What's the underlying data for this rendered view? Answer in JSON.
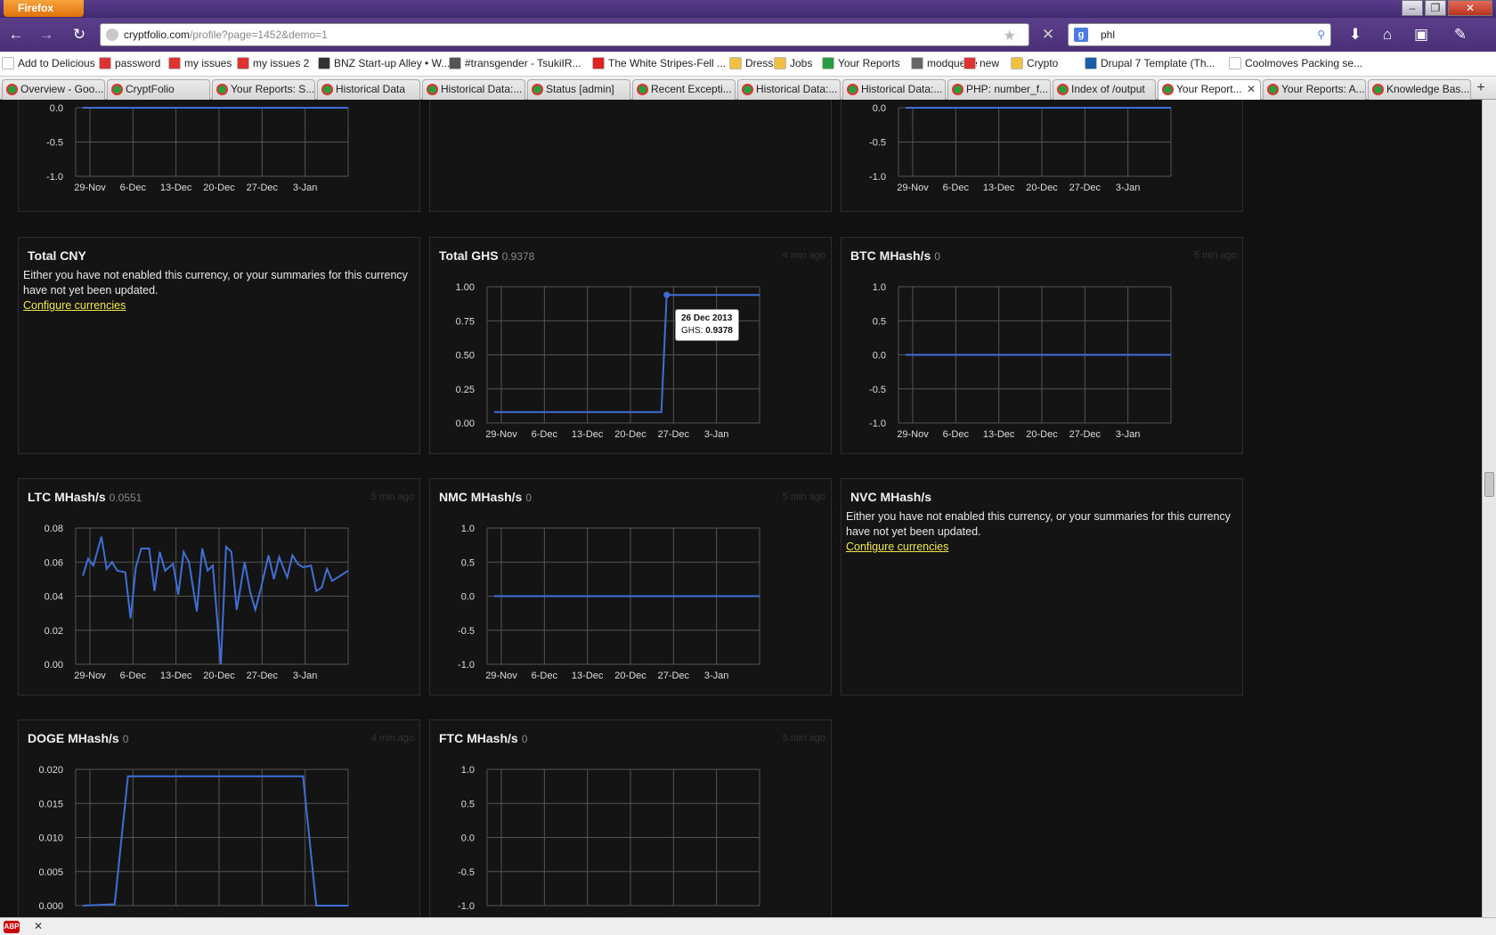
{
  "browser": {
    "menu_button": "Firefox",
    "url_host": "cryptfolio.com",
    "url_path": "/profile?page=1452&demo=1",
    "search_text": "phl",
    "search_engine_glyph": "g",
    "bookmarks": [
      "Add to Delicious",
      "password",
      "my issues",
      "my issues 2",
      "BNZ Start-up Alley • W...",
      "#transgender - TsukiIR...",
      "The White Stripes-Fell ...",
      "Dresses",
      "Jobs",
      "Your Reports",
      "modqueue",
      "new",
      "Crypto",
      "Drupal 7 Template (Th...",
      "Coolmoves Packing se..."
    ],
    "tabs": [
      "Overview - Goo...",
      "CryptFolio",
      "Your Reports: S...",
      "Historical Data",
      "Historical Data:...",
      "Status [admin]",
      "Recent Excepti...",
      "Historical Data:...",
      "Historical Data:...",
      "PHP: number_f...",
      "Index of /output",
      "Your Report...",
      "Your Reports: A...",
      "Knowledge Bas..."
    ],
    "active_tab_index": 11
  },
  "panels": {
    "top1": {},
    "top2": {},
    "top3": {},
    "cny": {
      "title": "Total CNY",
      "message": "Either you have not enabled this currency, or your summaries for this currency have not yet been updated.",
      "link": "Configure currencies"
    },
    "ghs": {
      "title": "Total GHS",
      "value": "0.9378",
      "ago": "4 min ago"
    },
    "btc": {
      "title": "BTC MHash/s",
      "value": "0",
      "ago": "5 min ago"
    },
    "ltc": {
      "title": "LTC MHash/s",
      "value": "0.0551",
      "ago": "5 min ago"
    },
    "nmc": {
      "title": "NMC MHash/s",
      "value": "0",
      "ago": "5 min ago"
    },
    "nvc": {
      "title": "NVC MHash/s",
      "message": "Either you have not enabled this currency, or your summaries for this currency have not yet been updated.",
      "link": "Configure currencies"
    },
    "doge": {
      "title": "DOGE MHash/s",
      "value": "0",
      "ago": "4 min ago"
    },
    "ftc": {
      "title": "FTC MHash/s",
      "value": "0",
      "ago": "5 min ago"
    }
  },
  "tooltip": {
    "date": "26 Dec 2013",
    "label": "GHS: ",
    "value": "0.9378"
  },
  "colors": {
    "line": "#3f6fd6",
    "link": "#f2e74a",
    "grid": "#555"
  },
  "chart_data": [
    {
      "id": "top1",
      "type": "line",
      "x": [
        "29-Nov",
        "6-Dec",
        "13-Dec",
        "20-Dec",
        "27-Dec",
        "3-Jan"
      ],
      "yticks": [
        "0.0",
        "-0.5",
        "-1.0"
      ],
      "ylim": [
        -1,
        0
      ],
      "series": [
        {
          "values": [
            [
              0,
              0
            ],
            [
              1,
              0
            ]
          ]
        }
      ]
    },
    {
      "id": "top3",
      "type": "line",
      "x": [
        "29-Nov",
        "6-Dec",
        "13-Dec",
        "20-Dec",
        "27-Dec",
        "3-Jan"
      ],
      "yticks": [
        "0.0",
        "-0.5",
        "-1.0"
      ],
      "ylim": [
        -1,
        0
      ],
      "series": [
        {
          "values": [
            [
              0,
              0
            ],
            [
              1,
              0
            ]
          ]
        }
      ]
    },
    {
      "id": "ghs",
      "type": "line",
      "x": [
        "29-Nov",
        "6-Dec",
        "13-Dec",
        "20-Dec",
        "27-Dec",
        "3-Jan"
      ],
      "yticks": [
        "1.00",
        "0.75",
        "0.50",
        "0.25",
        "0.00"
      ],
      "ylim": [
        0,
        1
      ],
      "series": [
        {
          "values": [
            [
              0,
              0.08
            ],
            [
              0.63,
              0.08
            ],
            [
              0.65,
              0.94
            ],
            [
              1,
              0.94
            ]
          ]
        }
      ]
    },
    {
      "id": "btc",
      "type": "line",
      "x": [
        "29-Nov",
        "6-Dec",
        "13-Dec",
        "20-Dec",
        "27-Dec",
        "3-Jan"
      ],
      "yticks": [
        "1.0",
        "0.5",
        "0.0",
        "-0.5",
        "-1.0"
      ],
      "ylim": [
        -1,
        1
      ],
      "series": [
        {
          "values": [
            [
              0,
              0
            ],
            [
              1,
              0
            ]
          ]
        }
      ]
    },
    {
      "id": "ltc",
      "type": "line",
      "x": [
        "29-Nov",
        "6-Dec",
        "13-Dec",
        "20-Dec",
        "27-Dec",
        "3-Jan"
      ],
      "yticks": [
        "0.08",
        "0.06",
        "0.04",
        "0.02",
        "0.00"
      ],
      "ylim": [
        0,
        0.08
      ],
      "series": [
        {
          "values": [
            [
              0,
              0.052
            ],
            [
              0.02,
              0.062
            ],
            [
              0.04,
              0.058
            ],
            [
              0.07,
              0.075
            ],
            [
              0.09,
              0.056
            ],
            [
              0.11,
              0.06
            ],
            [
              0.13,
              0.055
            ],
            [
              0.16,
              0.054
            ],
            [
              0.18,
              0.027
            ],
            [
              0.2,
              0.057
            ],
            [
              0.22,
              0.068
            ],
            [
              0.25,
              0.068
            ],
            [
              0.27,
              0.043
            ],
            [
              0.29,
              0.066
            ],
            [
              0.31,
              0.055
            ],
            [
              0.34,
              0.059
            ],
            [
              0.36,
              0.041
            ],
            [
              0.38,
              0.066
            ],
            [
              0.4,
              0.06
            ],
            [
              0.43,
              0.031
            ],
            [
              0.45,
              0.068
            ],
            [
              0.47,
              0.055
            ],
            [
              0.49,
              0.058
            ],
            [
              0.52,
              0.0
            ],
            [
              0.54,
              0.069
            ],
            [
              0.56,
              0.066
            ],
            [
              0.58,
              0.032
            ],
            [
              0.61,
              0.06
            ],
            [
              0.63,
              0.043
            ],
            [
              0.65,
              0.032
            ],
            [
              0.67,
              0.044
            ],
            [
              0.7,
              0.064
            ],
            [
              0.72,
              0.05
            ],
            [
              0.74,
              0.063
            ],
            [
              0.77,
              0.051
            ],
            [
              0.79,
              0.064
            ],
            [
              0.81,
              0.059
            ],
            [
              0.83,
              0.057
            ],
            [
              0.86,
              0.058
            ],
            [
              0.88,
              0.043
            ],
            [
              0.9,
              0.045
            ],
            [
              0.92,
              0.056
            ],
            [
              0.94,
              0.049
            ],
            [
              0.97,
              0.052
            ],
            [
              1,
              0.055
            ]
          ]
        }
      ]
    },
    {
      "id": "nmc",
      "type": "line",
      "x": [
        "29-Nov",
        "6-Dec",
        "13-Dec",
        "20-Dec",
        "27-Dec",
        "3-Jan"
      ],
      "yticks": [
        "1.0",
        "0.5",
        "0.0",
        "-0.5",
        "-1.0"
      ],
      "ylim": [
        -1,
        1
      ],
      "series": [
        {
          "values": [
            [
              0,
              0
            ],
            [
              1,
              0
            ]
          ]
        }
      ]
    },
    {
      "id": "doge",
      "type": "line",
      "x": [],
      "yticks": [
        "0.020",
        "0.015",
        "0.010",
        "0.005",
        "0.000"
      ],
      "ylim": [
        0,
        0.02
      ],
      "series": [
        {
          "values": [
            [
              0,
              0
            ],
            [
              0.12,
              0.0002
            ],
            [
              0.17,
              0.019
            ],
            [
              0.83,
              0.019
            ],
            [
              0.88,
              0.0
            ],
            [
              1,
              0
            ]
          ]
        }
      ]
    },
    {
      "id": "ftc",
      "type": "line",
      "x": [],
      "yticks": [
        "1.0",
        "0.5",
        "0.0",
        "-0.5",
        "-1.0"
      ],
      "ylim": [
        -1,
        1
      ],
      "series": []
    }
  ]
}
